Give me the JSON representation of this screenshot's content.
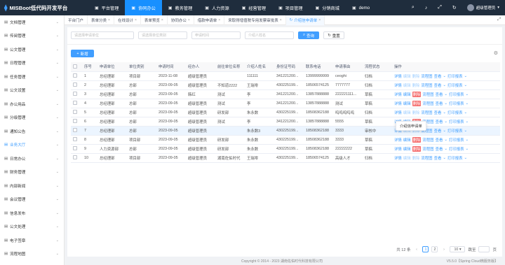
{
  "header": {
    "brand": "MISBoot低代码开发平台",
    "nav": [
      {
        "label": "平台管理",
        "icon": "home-icon",
        "active": false
      },
      {
        "label": "协同办公",
        "icon": "grid-icon",
        "active": true
      },
      {
        "label": "教务管理",
        "icon": "book-icon",
        "active": false
      },
      {
        "label": "人力资源",
        "icon": "people-icon",
        "active": false
      },
      {
        "label": "经营管理",
        "icon": "chart-icon",
        "active": false
      },
      {
        "label": "项目管理",
        "icon": "folder-icon",
        "active": false
      },
      {
        "label": "分销商城",
        "icon": "cart-icon",
        "active": false
      },
      {
        "label": "demo",
        "icon": "cube-icon",
        "active": false
      }
    ],
    "user": "超级管理员"
  },
  "sidebar": {
    "items": [
      {
        "label": "文档管理",
        "active": false
      },
      {
        "label": "传阅管理",
        "active": false
      },
      {
        "label": "公文管理",
        "active": false
      },
      {
        "label": "日程管理",
        "active": false
      },
      {
        "label": "任务管理",
        "active": false
      },
      {
        "label": "公文设置",
        "active": false
      },
      {
        "label": "办公用品",
        "active": false
      },
      {
        "label": "分级管理",
        "active": false
      },
      {
        "label": "通知公告",
        "active": false
      },
      {
        "label": "业务大厅",
        "active": true
      },
      {
        "label": "日常办公",
        "active": false
      },
      {
        "label": "财务管理",
        "active": false
      },
      {
        "label": "内部新闻",
        "active": false
      },
      {
        "label": "会议管理",
        "active": false
      },
      {
        "label": "信息发布",
        "active": false
      },
      {
        "label": "公文处理",
        "active": false
      },
      {
        "label": "电子签章",
        "active": false
      },
      {
        "label": "流程地图",
        "active": false
      }
    ]
  },
  "tabs": [
    {
      "label": "平台门户",
      "closable": false,
      "active": false
    },
    {
      "label": "表单分类",
      "closable": true,
      "active": false
    },
    {
      "label": "在线设计",
      "closable": true,
      "active": false
    },
    {
      "label": "表单预览",
      "closable": true,
      "active": false
    },
    {
      "label": "协同办公",
      "closable": true,
      "active": false
    },
    {
      "label": "借款申请单",
      "closable": true,
      "active": false
    },
    {
      "label": "来取得增值税专用发票审批表",
      "closable": true,
      "active": false
    },
    {
      "label": "介绍信申请单",
      "closable": true,
      "active": true
    }
  ],
  "filters": {
    "applicant_unit_placeholder": "请选择申请单位",
    "unit_type_placeholder": "请选择单位类别",
    "apply_time_placeholder": "申请时间",
    "introducer_placeholder": "介绍人姓名",
    "search_label": "查询",
    "reset_label": "重置"
  },
  "toolbar": {
    "add_label": "新增"
  },
  "table": {
    "columns": [
      "序号",
      "申请单位",
      "单位类别",
      "申请时间",
      "经办人",
      "前往单位名称",
      "介绍人姓名",
      "身份证号码",
      "联系电话",
      "申请事由",
      "流程状态",
      "操作"
    ],
    "rows": [
      {
        "no": "1",
        "unit": "总经理部",
        "type": "项目部",
        "time": "2023-11-08",
        "handler": "超级管理员",
        "dest": "",
        "intro": "111111",
        "idno": "341221200...",
        "phone": "13999999999",
        "reason": "ceoghi",
        "status": "归档",
        "highlight": false
      },
      {
        "no": "2",
        "unit": "总经理部",
        "type": "总部",
        "time": "2023-09-05",
        "handler": "超级管理员",
        "dest": "不知道2222",
        "intro": "王瑞零",
        "idno": "430225199...",
        "phone": "18506574125",
        "reason": "7777777",
        "status": "归档",
        "highlight": false
      },
      {
        "no": "3",
        "unit": "总经理部",
        "type": "总部",
        "time": "2023-09-05",
        "handler": "韩红",
        "dest": "测试",
        "intro": "李",
        "idno": "341221200...",
        "phone": "13857888888",
        "reason": "222221111...",
        "status": "草稿",
        "highlight": false
      },
      {
        "no": "4",
        "unit": "总经理部",
        "type": "总部",
        "time": "2023-09-05",
        "handler": "超级管理员",
        "dest": "测试",
        "intro": "李",
        "idno": "341221200...",
        "phone": "13857888888",
        "reason": "测试",
        "status": "草稿",
        "highlight": false
      },
      {
        "no": "5",
        "unit": "总经理部",
        "type": "总部",
        "time": "2023-09-05",
        "handler": "超级管理员",
        "dest": "研发部",
        "intro": "朱永数",
        "idno": "430225199...",
        "phone": "18508362188",
        "reason": "呜呜呜呜呜",
        "status": "归档",
        "highlight": false
      },
      {
        "no": "6",
        "unit": "总经理部",
        "type": "总部",
        "time": "2023-09-05",
        "handler": "超级管理员",
        "dest": "测试",
        "intro": "李",
        "idno": "341221200...",
        "phone": "13857888888",
        "reason": "5555",
        "status": "草稿",
        "highlight": false
      },
      {
        "no": "7",
        "unit": "总经理部",
        "type": "总部",
        "time": "2023-09-05",
        "handler": "超级管理员",
        "dest": "",
        "intro": "朱永数3",
        "idno": "430225199...",
        "phone": "18508362188",
        "reason": "3333",
        "status": "审核中",
        "highlight": true
      },
      {
        "no": "8",
        "unit": "总经理部",
        "type": "项目部",
        "time": "2023-09-05",
        "handler": "超级管理员",
        "dest": "研发部",
        "intro": "朱永数",
        "idno": "430225199...",
        "phone": "18508362188",
        "reason": "3333",
        "status": "草稿",
        "highlight": false
      },
      {
        "no": "9",
        "unit": "人力资源部",
        "type": "总部",
        "time": "2023-09-05",
        "handler": "超级管理员",
        "dest": "研发部",
        "intro": "朱永数",
        "idno": "430225199...",
        "phone": "18508362188",
        "reason": "22222222",
        "status": "草稿",
        "highlight": false
      },
      {
        "no": "10",
        "unit": "总经理部",
        "type": "项目部",
        "time": "2023-09-05",
        "handler": "超级管理员",
        "dest": "湖南佐佑时代",
        "intro": "王瑞零",
        "idno": "430225199...",
        "phone": "18506574125",
        "reason": "高级人才",
        "status": "归档",
        "highlight": false
      }
    ],
    "actions": {
      "detail": "详情",
      "edit": "编辑",
      "delete": "删除",
      "flow": "流程图",
      "more": "查看",
      "print": "打印报表"
    }
  },
  "tooltip": "介绍信申请单",
  "pagination": {
    "total": "共 12 条",
    "pages": [
      "1",
      "2"
    ],
    "current": "1",
    "page_size": "10",
    "goto_label": "跳至",
    "page_unit": "页"
  },
  "footer": {
    "copyright": "Copyright © 2014 - 2023 湖南佐佑时代科技有限公司",
    "version": "V5.5.0【Spring Cloud微服务版】"
  }
}
